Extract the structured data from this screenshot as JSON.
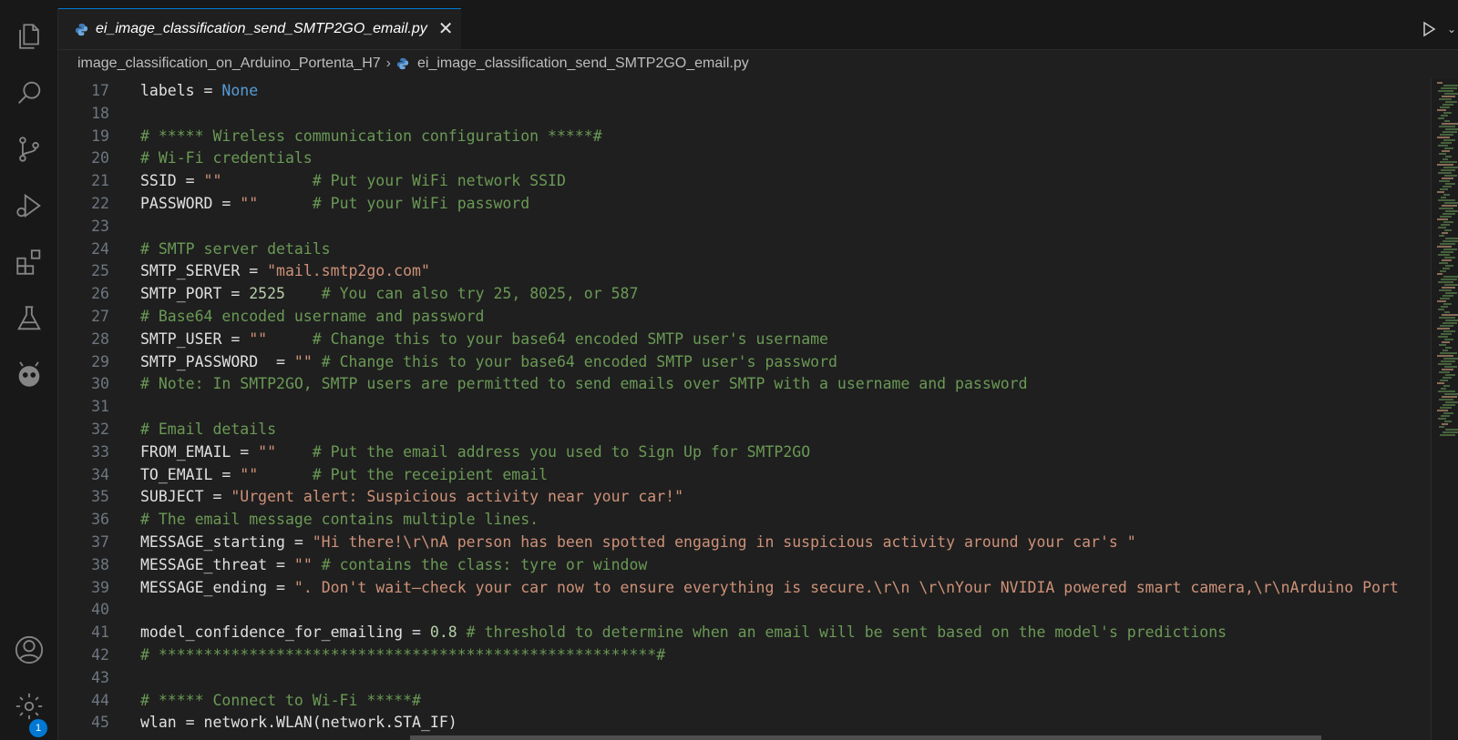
{
  "tab": {
    "filename": "ei_image_classification_send_SMTP2GO_email.py",
    "close": "✕"
  },
  "breadcrumb": {
    "folder": "image_classification_on_Arduino_Portenta_H7",
    "separator": "›",
    "file": "ei_image_classification_send_SMTP2GO_email.py"
  },
  "activity_bar": [
    "explorer-icon",
    "search-icon",
    "source-control-icon",
    "run-debug-icon",
    "extensions-icon",
    "testing-icon",
    "platformio-icon",
    "account-icon",
    "settings-gear-icon"
  ],
  "settings_badge": "1",
  "colors": {
    "comment": "#6a9955",
    "string": "#ce9178",
    "keyword": "#569cd6",
    "number": "#b5cea8",
    "accent": "#0078d4"
  },
  "lines": [
    {
      "n": "17",
      "t": [
        [
          "p",
          "labels = "
        ],
        [
          "k",
          "None"
        ]
      ]
    },
    {
      "n": "18",
      "t": []
    },
    {
      "n": "19",
      "t": [
        [
          "c",
          "# ***** Wireless communication configuration *****#"
        ]
      ]
    },
    {
      "n": "20",
      "t": [
        [
          "c",
          "# Wi-Fi credentials"
        ]
      ]
    },
    {
      "n": "21",
      "t": [
        [
          "p",
          "SSID = "
        ],
        [
          "s",
          "\"\""
        ],
        [
          "p",
          "          "
        ],
        [
          "c",
          "# Put your WiFi network SSID"
        ]
      ]
    },
    {
      "n": "22",
      "t": [
        [
          "p",
          "PASSWORD = "
        ],
        [
          "s",
          "\"\""
        ],
        [
          "p",
          "      "
        ],
        [
          "c",
          "# Put your WiFi password"
        ]
      ]
    },
    {
      "n": "23",
      "t": []
    },
    {
      "n": "24",
      "t": [
        [
          "c",
          "# SMTP server details"
        ]
      ]
    },
    {
      "n": "25",
      "t": [
        [
          "p",
          "SMTP_SERVER = "
        ],
        [
          "s",
          "\"mail.smtp2go.com\""
        ]
      ]
    },
    {
      "n": "26",
      "t": [
        [
          "p",
          "SMTP_PORT = "
        ],
        [
          "n",
          "2525"
        ],
        [
          "p",
          "    "
        ],
        [
          "c",
          "# You can also try 25, 8025, or 587"
        ]
      ]
    },
    {
      "n": "27",
      "t": [
        [
          "c",
          "# Base64 encoded username and password"
        ]
      ]
    },
    {
      "n": "28",
      "t": [
        [
          "p",
          "SMTP_USER = "
        ],
        [
          "s",
          "\"\""
        ],
        [
          "p",
          "     "
        ],
        [
          "c",
          "# Change this to your base64 encoded SMTP user's username"
        ]
      ]
    },
    {
      "n": "29",
      "t": [
        [
          "p",
          "SMTP_PASSWORD  = "
        ],
        [
          "s",
          "\"\""
        ],
        [
          "p",
          " "
        ],
        [
          "c",
          "# Change this to your base64 encoded SMTP user's password"
        ]
      ]
    },
    {
      "n": "30",
      "t": [
        [
          "c",
          "# Note: In SMTP2GO, SMTP users are permitted to send emails over SMTP with a username and password"
        ]
      ]
    },
    {
      "n": "31",
      "t": []
    },
    {
      "n": "32",
      "t": [
        [
          "c",
          "# Email details"
        ]
      ]
    },
    {
      "n": "33",
      "t": [
        [
          "p",
          "FROM_EMAIL = "
        ],
        [
          "s",
          "\"\""
        ],
        [
          "p",
          "    "
        ],
        [
          "c",
          "# Put the email address you used to Sign Up for SMTP2GO"
        ]
      ]
    },
    {
      "n": "34",
      "t": [
        [
          "p",
          "TO_EMAIL = "
        ],
        [
          "s",
          "\"\""
        ],
        [
          "p",
          "      "
        ],
        [
          "c",
          "# Put the receipient email"
        ]
      ]
    },
    {
      "n": "35",
      "t": [
        [
          "p",
          "SUBJECT = "
        ],
        [
          "s",
          "\"Urgent alert: Suspicious activity near your car!\""
        ]
      ]
    },
    {
      "n": "36",
      "t": [
        [
          "c",
          "# The email message contains multiple lines."
        ]
      ]
    },
    {
      "n": "37",
      "t": [
        [
          "p",
          "MESSAGE_starting = "
        ],
        [
          "s",
          "\"Hi there!\\r\\nA person has been spotted engaging in suspicious activity around your car's \""
        ]
      ]
    },
    {
      "n": "38",
      "t": [
        [
          "p",
          "MESSAGE_threat = "
        ],
        [
          "s",
          "\"\""
        ],
        [
          "p",
          " "
        ],
        [
          "c",
          "# contains the class: tyre or window"
        ]
      ]
    },
    {
      "n": "39",
      "t": [
        [
          "p",
          "MESSAGE_ending = "
        ],
        [
          "s",
          "\". Don't wait—check your car now to ensure everything is secure.\\r\\n \\r\\nYour NVIDIA powered smart camera,\\r\\nArduino Port"
        ]
      ]
    },
    {
      "n": "40",
      "t": []
    },
    {
      "n": "41",
      "t": [
        [
          "p",
          "model_confidence_for_emailing = "
        ],
        [
          "n",
          "0.8"
        ],
        [
          "p",
          " "
        ],
        [
          "c",
          "# threshold to determine when an email will be sent based on the model's predictions"
        ]
      ]
    },
    {
      "n": "42",
      "t": [
        [
          "c",
          "# *******************************************************#"
        ]
      ]
    },
    {
      "n": "43",
      "t": []
    },
    {
      "n": "44",
      "t": [
        [
          "c",
          "# ***** Connect to Wi-Fi *****#"
        ]
      ]
    },
    {
      "n": "45",
      "t": [
        [
          "p",
          "wlan = network.WLAN(network.STA_IF)"
        ]
      ]
    }
  ]
}
